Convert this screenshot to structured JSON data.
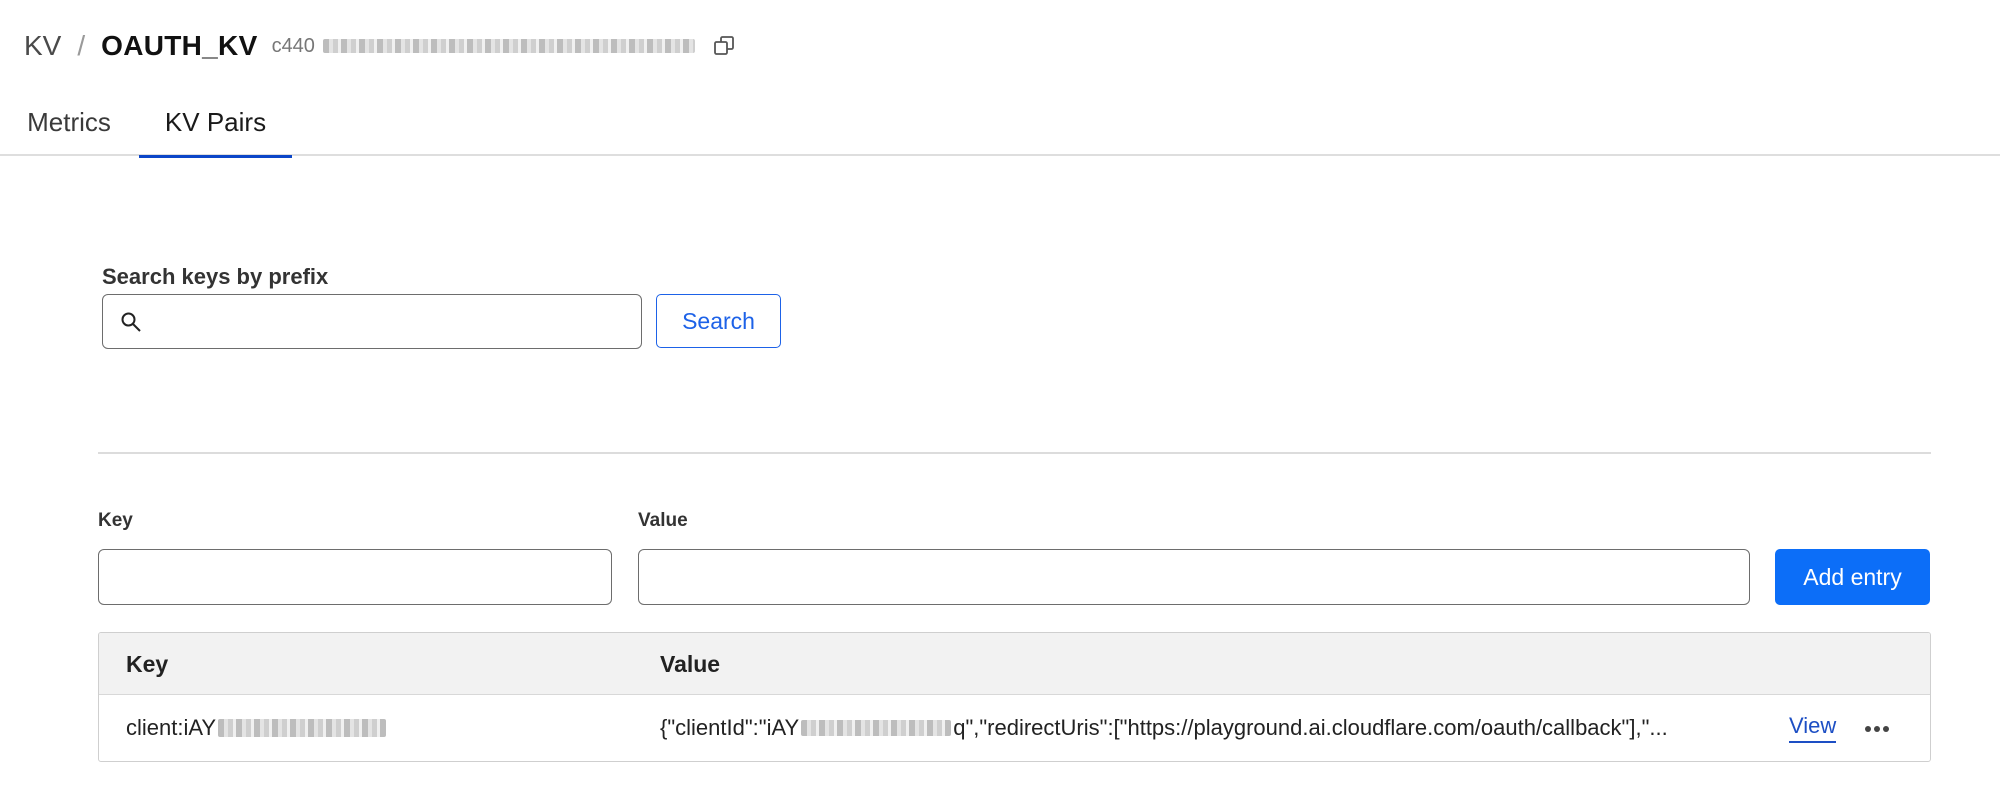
{
  "header": {
    "breadcrumb_root": "KV",
    "separator": "/",
    "namespace_title": "OAUTH_KV",
    "namespace_id_prefix": "c440"
  },
  "tabs": [
    {
      "label": "Metrics",
      "active": false
    },
    {
      "label": "KV Pairs",
      "active": true
    }
  ],
  "search": {
    "label": "Search keys by prefix",
    "value": "",
    "placeholder": "",
    "button_label": "Search"
  },
  "add_entry": {
    "key_label": "Key",
    "value_label": "Value",
    "key_value": "",
    "value_value": "",
    "button_label": "Add entry"
  },
  "table": {
    "columns": [
      "Key",
      "Value"
    ],
    "rows": [
      {
        "key_prefix": "client:iAY",
        "value_prefix": "{\"clientId\":\"iAY",
        "value_suffix": "q\",\"redirectUris\":[\"https://playground.ai.cloudflare.com/oauth/callback\"],\"...",
        "action_label": "View"
      }
    ]
  },
  "colors": {
    "accent": "#0c6ef8",
    "tab_indicator": "#0b46c8",
    "link": "#1d4fc4"
  },
  "icons": [
    "copy-icon",
    "search-icon",
    "more-horizontal-icon"
  ]
}
